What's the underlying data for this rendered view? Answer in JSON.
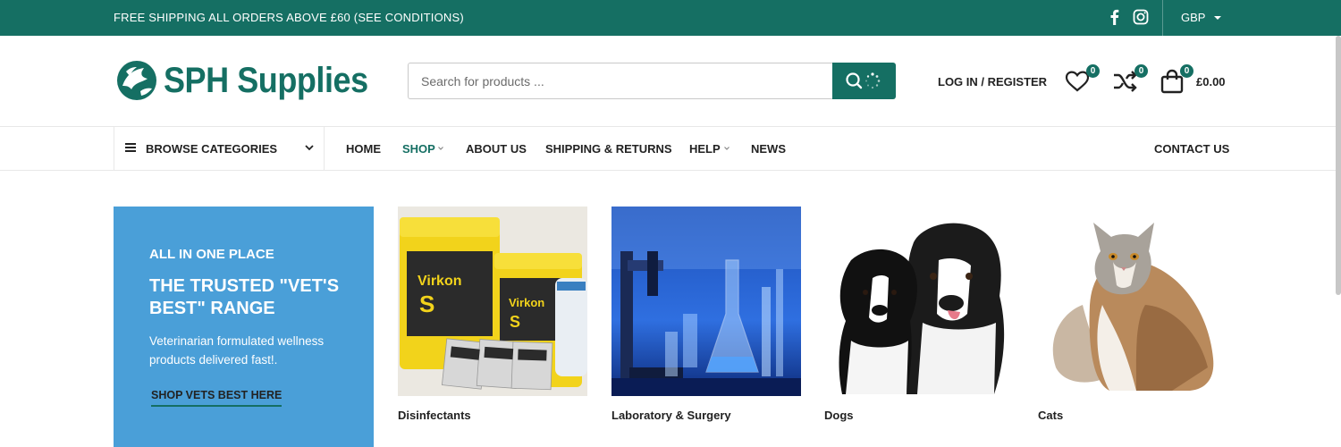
{
  "topbar": {
    "promo": "FREE SHIPPING ALL ORDERS ABOVE £60 (SEE CONDITIONS)",
    "social": [
      "facebook-icon",
      "instagram-icon"
    ],
    "currency": "GBP"
  },
  "header": {
    "logo_text": "SPH Supplies",
    "search_placeholder": "Search for products ...",
    "login_label": "LOG IN / REGISTER",
    "wishlist_count": "0",
    "compare_count": "0",
    "cart_count": "0",
    "cart_total": "£0.00"
  },
  "nav": {
    "browse_label": "BROWSE CATEGORIES",
    "items": [
      {
        "label": "HOME",
        "active": false,
        "dropdown": false
      },
      {
        "label": "SHOP",
        "active": true,
        "dropdown": true
      },
      {
        "label": "ABOUT US",
        "active": false,
        "dropdown": false
      },
      {
        "label": "SHIPPING & RETURNS",
        "active": false,
        "dropdown": false
      },
      {
        "label": "HELP",
        "active": false,
        "dropdown": true
      },
      {
        "label": "NEWS",
        "active": false,
        "dropdown": false
      }
    ],
    "contact_label": "CONTACT US"
  },
  "promo": {
    "kicker": "ALL IN ONE PLACE",
    "heading": "THE TRUSTED \"VET'S BEST\" RANGE",
    "description": "Veterinarian formulated wellness products delivered fast!.",
    "cta": "SHOP VETS BEST HERE"
  },
  "categories": [
    {
      "name": "Disinfectants",
      "image": "disinfectant-products"
    },
    {
      "name": "Laboratory & Surgery",
      "image": "lab-glassware"
    },
    {
      "name": "Dogs",
      "image": "border-collie-dogs"
    },
    {
      "name": "Cats",
      "image": "long-haired-cat"
    }
  ],
  "colors": {
    "brand": "#156f63",
    "promo_bg": "#4a9fd8"
  }
}
